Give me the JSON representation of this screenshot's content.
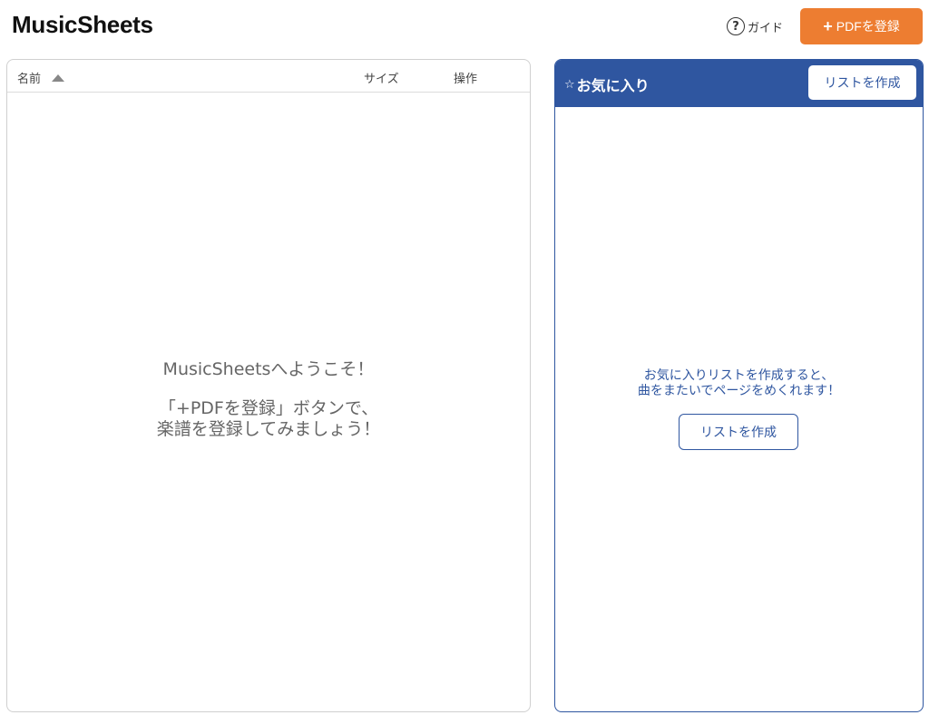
{
  "header": {
    "app_title": "MusicSheets",
    "guide_icon_glyph": "?",
    "guide_label": "ガイド",
    "add_pdf_plus": "+",
    "add_pdf_label": "PDFを登録"
  },
  "file_list": {
    "columns": {
      "name": "名前",
      "size": "サイズ",
      "actions": "操作"
    },
    "sort": {
      "column": "name",
      "direction": "ascending",
      "icon": "triangle-up-icon"
    },
    "empty_message": {
      "line1": "MusicSheetsへようこそ！",
      "line2": "「+PDFを登録」ボタンで、",
      "line3": "楽譜を登録してみましょう！"
    }
  },
  "favorites": {
    "star_glyph": "☆",
    "title": "お気に入り",
    "create_list_button_top": "リストを作成",
    "message_line1": "お気に入りリストを作成すると、",
    "message_line2": "曲をまたいでページをめくれます！",
    "create_list_button_center": "リストを作成"
  },
  "colors": {
    "accent_orange": "#ed7d31",
    "favorites_blue": "#2f56a0",
    "muted_text": "#666666"
  }
}
